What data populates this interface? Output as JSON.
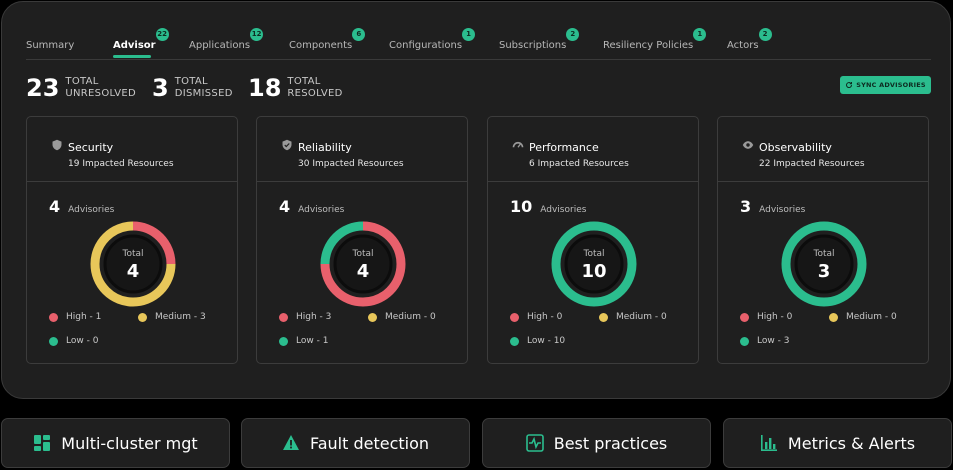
{
  "tabs": [
    {
      "label": "Summary",
      "badge": ""
    },
    {
      "label": "Advisor",
      "badge": "22"
    },
    {
      "label": "Applications",
      "badge": "12"
    },
    {
      "label": "Components",
      "badge": "6"
    },
    {
      "label": "Configurations",
      "badge": "1"
    },
    {
      "label": "Subscriptions",
      "badge": "2"
    },
    {
      "label": "Resiliency Policies",
      "badge": "1"
    },
    {
      "label": "Actors",
      "badge": "2"
    }
  ],
  "stats": [
    {
      "value": "23",
      "line1": "TOTAL",
      "line2": "UNRESOLVED"
    },
    {
      "value": "3",
      "line1": "TOTAL",
      "line2": "DISMISSED"
    },
    {
      "value": "18",
      "line1": "TOTAL",
      "line2": "RESOLVED"
    }
  ],
  "sync_button": "SYNC ADVISORIES",
  "advisory_label": "Advisories",
  "total_label": "Total",
  "colors": {
    "high": "#e8606c",
    "medium": "#e8c75a",
    "low": "#2bbd8e",
    "accent": "#2bbd8e"
  },
  "cards": [
    {
      "title": "Security",
      "icon": "shield-icon",
      "impacted": "19 Impacted Resources",
      "count": "4",
      "high": 1,
      "medium": 3,
      "low": 0,
      "legend": {
        "high": "High - 1",
        "medium": "Medium - 3",
        "low": "Low - 0"
      }
    },
    {
      "title": "Reliability",
      "icon": "shield-check-icon",
      "impacted": "30 Impacted Resources",
      "count": "4",
      "high": 3,
      "medium": 0,
      "low": 1,
      "legend": {
        "high": "High - 3",
        "medium": "Medium - 0",
        "low": "Low - 1"
      }
    },
    {
      "title": "Performance",
      "icon": "gauge-icon",
      "impacted": "6 Impacted Resources",
      "count": "10",
      "high": 0,
      "medium": 0,
      "low": 10,
      "legend": {
        "high": "High - 0",
        "medium": "Medium - 0",
        "low": "Low - 10"
      }
    },
    {
      "title": "Observability",
      "icon": "eye-icon",
      "impacted": "22 Impacted Resources",
      "count": "3",
      "high": 0,
      "medium": 0,
      "low": 3,
      "legend": {
        "high": "High - 0",
        "medium": "Medium - 0",
        "low": "Low - 3"
      }
    }
  ],
  "features": [
    {
      "label": "Multi-cluster mgt",
      "icon": "dashboard-icon"
    },
    {
      "label": "Fault detection",
      "icon": "warning-icon"
    },
    {
      "label": "Best practices",
      "icon": "pulse-icon"
    },
    {
      "label": "Metrics & Alerts",
      "icon": "bar-chart-icon"
    }
  ]
}
